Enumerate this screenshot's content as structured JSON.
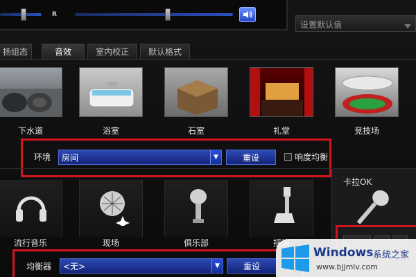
{
  "top": {
    "right_channel_label": "R",
    "speaker_icon": "speaker-icon"
  },
  "default_select": {
    "value": "设置默认值"
  },
  "tabs": [
    {
      "label": "扬组态"
    },
    {
      "label": "音效"
    },
    {
      "label": "室内校正"
    },
    {
      "label": "默认格式"
    }
  ],
  "environments": [
    {
      "label": "下水道"
    },
    {
      "label": "浴室"
    },
    {
      "label": "石室"
    },
    {
      "label": "礼堂"
    },
    {
      "label": "竞技场"
    }
  ],
  "environment_row": {
    "label": "环境",
    "selected": "房间",
    "reset_label": "重设",
    "loudness_label": "响度均衡"
  },
  "genres": [
    {
      "label": "流行音乐"
    },
    {
      "label": "现场"
    },
    {
      "label": "俱乐部"
    },
    {
      "label": "摇滚"
    }
  ],
  "karaoke": {
    "label": "卡拉OK"
  },
  "equalizer_row": {
    "label": "均衡器",
    "selected": "<无>",
    "reset_label": "重设"
  },
  "watermark": {
    "title": "Windows",
    "title_suffix": "系统之家",
    "url": "www.bjjmlv.com"
  },
  "colors": {
    "highlight_box": "#d4141c",
    "accent_blue": "#2c4ab5"
  }
}
